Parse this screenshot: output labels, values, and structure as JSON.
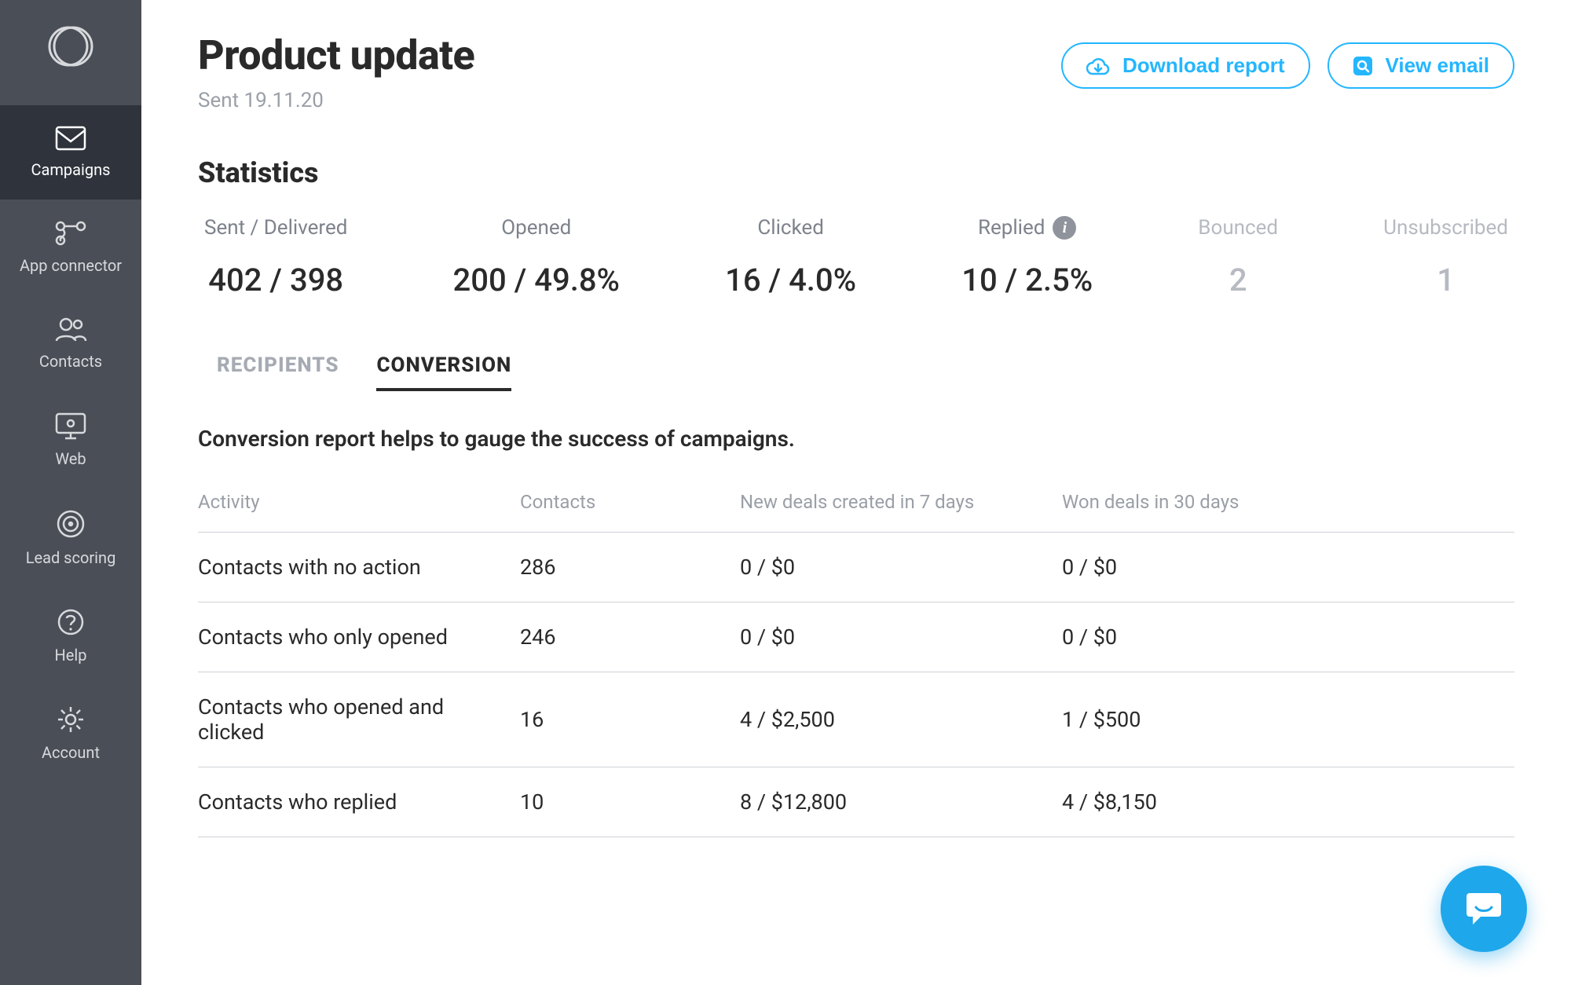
{
  "sidebar": {
    "items": [
      {
        "label": "Campaigns"
      },
      {
        "label": "App connector"
      },
      {
        "label": "Contacts"
      },
      {
        "label": "Web"
      },
      {
        "label": "Lead scoring"
      },
      {
        "label": "Help"
      },
      {
        "label": "Account"
      }
    ]
  },
  "header": {
    "title": "Product update",
    "sent_line": "Sent 19.11.20",
    "download_label": "Download report",
    "view_email_label": "View email"
  },
  "statistics": {
    "title": "Statistics",
    "items": [
      {
        "label": "Sent / Delivered",
        "value": "402 / 398"
      },
      {
        "label": "Opened",
        "value": "200 / 49.8%"
      },
      {
        "label": "Clicked",
        "value": "16 / 4.0%"
      },
      {
        "label": "Replied",
        "value": "10 / 2.5%"
      },
      {
        "label": "Bounced",
        "value": "2"
      },
      {
        "label": "Unsubscribed",
        "value": "1"
      }
    ]
  },
  "tabs": {
    "recipients": "RECIPIENTS",
    "conversion": "CONVERSION"
  },
  "conversion": {
    "description": "Conversion report helps to gauge the success of campaigns.",
    "columns": {
      "activity": "Activity",
      "contacts": "Contacts",
      "new_deals": "New deals created in 7 days",
      "won_deals": "Won deals in 30 days"
    },
    "rows": [
      {
        "activity": "Contacts with no action",
        "contacts": "286",
        "new_deals": "0 / $0",
        "won_deals": "0 / $0"
      },
      {
        "activity": "Contacts who only opened",
        "contacts": "246",
        "new_deals": "0 / $0",
        "won_deals": "0 / $0"
      },
      {
        "activity": "Contacts who opened and clicked",
        "contacts": "16",
        "new_deals": "4 / $2,500",
        "won_deals": "1 / $500"
      },
      {
        "activity": "Contacts who replied",
        "contacts": "10",
        "new_deals": "8 / $12,800",
        "won_deals": "4 / $8,150"
      }
    ]
  }
}
